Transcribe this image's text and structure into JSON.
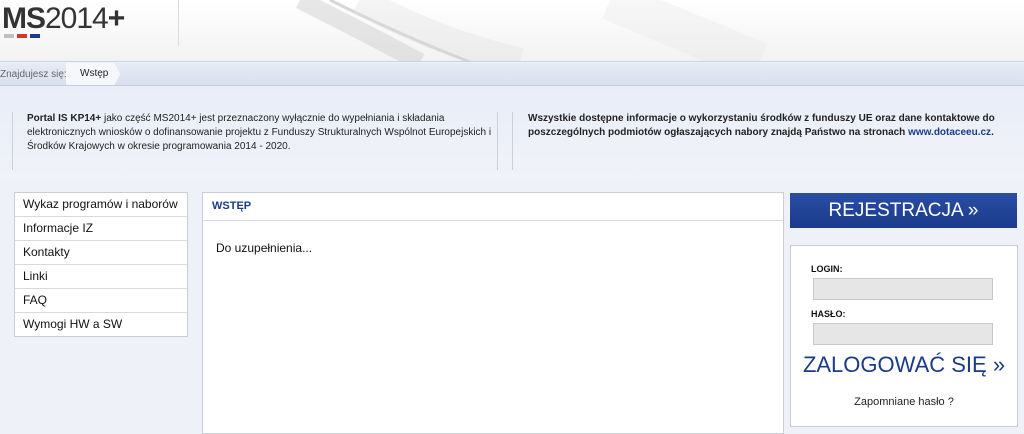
{
  "header": {
    "logo_bold": "MS",
    "logo_rest": "2014",
    "logo_plus": "+",
    "logo_bar_colors": [
      "#c0c0c0",
      "#d9322a",
      "#1a3a8a"
    ]
  },
  "breadcrumb": {
    "prefix": "Znajdujesz się:",
    "current": "Wstęp"
  },
  "info": {
    "left_bold": "Portal IS KP14+",
    "left_text": " jako część MS2014+ jest przeznaczony wyłącznie do wypełniania i składania elektronicznych wniosków o dofinansowanie projektu z Funduszy Strukturalnych Wspólnot Europejskich i Środków Krajowych w okresie programowania 2014 - 2020.",
    "right_text": "Wszystkie dostępne informacje o wykorzystaniu środków z funduszy UE oraz dane kontaktowe do poszczególnych podmiotów ogłaszających nabory znajdą Państwo na stronach ",
    "right_link": "www.dotaceeu.cz",
    "right_end": "."
  },
  "menu": {
    "items": [
      "Wykaz programów i naborów",
      "Informacje IZ",
      "Kontakty",
      "Linki",
      "FAQ",
      "Wymogi HW a SW"
    ]
  },
  "main": {
    "title": "WSTĘP",
    "body": "Do uzupełnienia..."
  },
  "side": {
    "register_label": "REJESTRACJA »",
    "login_label": "LOGIN:",
    "password_label": "HASŁO:",
    "login_value": "",
    "password_value": "",
    "login_button": "ZALOGOWAĆ SIĘ »",
    "forgot_label": "Zapomniane hasło ?"
  },
  "colors": {
    "accent": "#1a3a8a"
  }
}
